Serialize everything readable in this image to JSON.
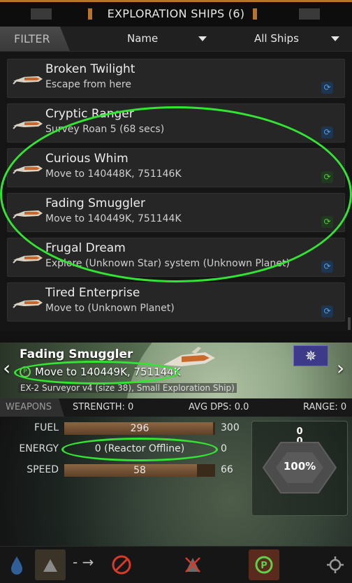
{
  "header": {
    "title": "EXPLORATION SHIPS (6)"
  },
  "filter": {
    "tab_label": "FILTER",
    "sort_value": "Name",
    "type_value": "All Ships"
  },
  "ships": [
    {
      "name": "Broken Twilight",
      "status": "Escape from here",
      "badge": "blue"
    },
    {
      "name": "Cryptic Ranger",
      "status": "Survey Roan 5 (68 secs)",
      "badge": "blue"
    },
    {
      "name": "Curious Whim",
      "status": "Move to 140448K, 751146K",
      "badge": "green"
    },
    {
      "name": "Fading Smuggler",
      "status": "Move to 140449K, 751144K",
      "badge": "green"
    },
    {
      "name": "Frugal Dream",
      "status": "Explore (Unknown Star) system (Unknown Planet)",
      "badge": "blue"
    },
    {
      "name": "Tired Enterprise",
      "status": "Move to (Unknown Planet)",
      "badge": "blue"
    }
  ],
  "selected": {
    "name": "Fading Smuggler",
    "status": "Move to 140449K, 751144K",
    "class": "EX-2 Surveyor v4 (size 38), Small Exploration Ship)"
  },
  "weapons": {
    "tab_label": "WEAPONS",
    "strength": "STRENGTH: 0",
    "avg_dps": "AVG DPS: 0.0",
    "range": "RANGE: 0"
  },
  "stats": {
    "fuel": {
      "label": "FUEL",
      "value": "296",
      "max": "300",
      "fill_fraction": 0.987
    },
    "energy": {
      "label": "ENERGY",
      "value": "0 (Reactor Offline)",
      "max": "0"
    },
    "speed": {
      "label": "SPEED",
      "value": "58",
      "max": "66",
      "fill_fraction": 0.879
    }
  },
  "shield": {
    "top_value": "0",
    "second_value": "0",
    "percent": "100%"
  },
  "toolbar": {
    "move_arrow": "- →"
  },
  "colors": {
    "accent_orange": "#b8742e",
    "annotation_green": "#33e533",
    "status_green": "#5fbf4a",
    "status_blue": "#5b9bd8"
  }
}
